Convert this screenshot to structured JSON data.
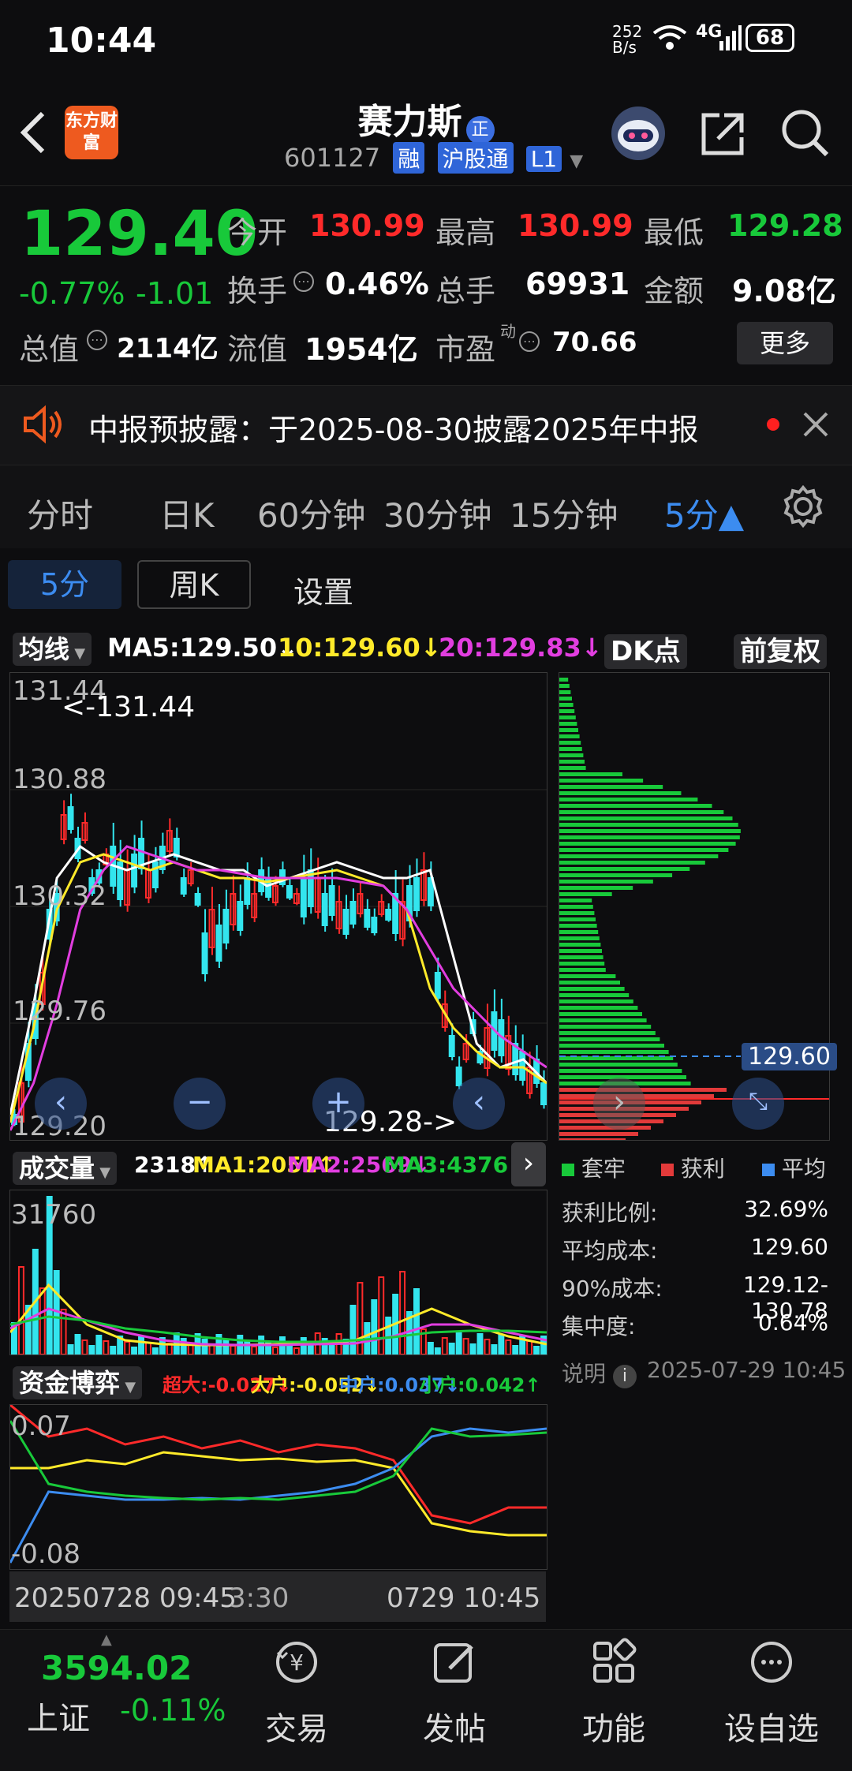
{
  "status": {
    "time": "10:44",
    "net_speed": "252 B/s",
    "network": "4G",
    "battery": "68"
  },
  "header": {
    "title": "赛力斯",
    "title_badge": "正",
    "code": "601127",
    "tags": [
      "融",
      "沪股通",
      "L1"
    ],
    "broker_logo": "东方财富"
  },
  "quote": {
    "price": "129.40",
    "change_pct": "-0.77%",
    "change": "-1.01",
    "open_label": "今开",
    "open": "130.99",
    "high_label": "最高",
    "high": "130.99",
    "low_label": "最低",
    "low": "129.28",
    "turnover_label": "换手",
    "turnover": "0.46%",
    "volume_label": "总手",
    "volume": "69931",
    "amount_label": "金额",
    "amount": "9.08亿",
    "mktcap_label": "总值",
    "mktcap": "2114亿",
    "float_label": "流值",
    "float": "1954亿",
    "pe_label": "市盈",
    "pe_sup": "动",
    "pe": "70.66",
    "more": "更多"
  },
  "notice": {
    "text": "中报预披露：于2025-08-30披露2025年中报"
  },
  "tabs": [
    "分时",
    "日K",
    "60分钟",
    "30分钟",
    "15分钟",
    "5分▲"
  ],
  "active_tab": "5分▲",
  "subtabs": {
    "current": "5分",
    "weekly": "周K",
    "settings": "设置"
  },
  "ma": {
    "dropdown": "均线",
    "ma5": "MA5:129.50↓",
    "ma10": "10:129.60↓",
    "ma20": "20:129.83↓",
    "dk": "DK点",
    "fq": "前复权"
  },
  "price_axis": [
    "131.44",
    "130.88",
    "130.32",
    "129.76",
    "129.20"
  ],
  "price_annot": {
    "high": "<-131.44",
    "low": "129.28->"
  },
  "volume_row": {
    "dropdown": "成交量",
    "v": "2318↑",
    "ma1": "MA1:2051↑",
    "ma2": "MA2:2569↓",
    "ma3": "MA3:4376↑",
    "axis_top": "31760"
  },
  "fund_row": {
    "dropdown": "资金博弈",
    "super": "超大:-0.027↓",
    "large": "大户:-0.052↓",
    "mid": "中户:0.037↓",
    "small": "小户:0.042↑",
    "axis_top": "0.07",
    "axis_bottom": "-0.08"
  },
  "time_axis": {
    "start": "20250728 09:45",
    "mid": "3:30",
    "end": "0729 10:45"
  },
  "chips": {
    "legend": [
      "套牢",
      "获利",
      "平均"
    ],
    "current": "129.60",
    "profit_ratio_label": "获利比例:",
    "profit_ratio": "32.69%",
    "avg_cost_label": "平均成本:",
    "avg_cost": "129.60",
    "cost90_label": "90%成本:",
    "cost90": "129.12-130.78",
    "concentration_label": "集中度:",
    "concentration": "0.64%",
    "explain": "说明",
    "date": "2025-07-29 10:45"
  },
  "nav": {
    "index_value": "3594.02",
    "index_name": "上证",
    "index_change": "-0.11%",
    "items": [
      "交易",
      "发帖",
      "功能",
      "设自选"
    ]
  },
  "colors": {
    "up": "#ff2a2a",
    "down": "#18c93a",
    "cyan": "#33e5ee",
    "accent": "#2f65d8"
  }
}
